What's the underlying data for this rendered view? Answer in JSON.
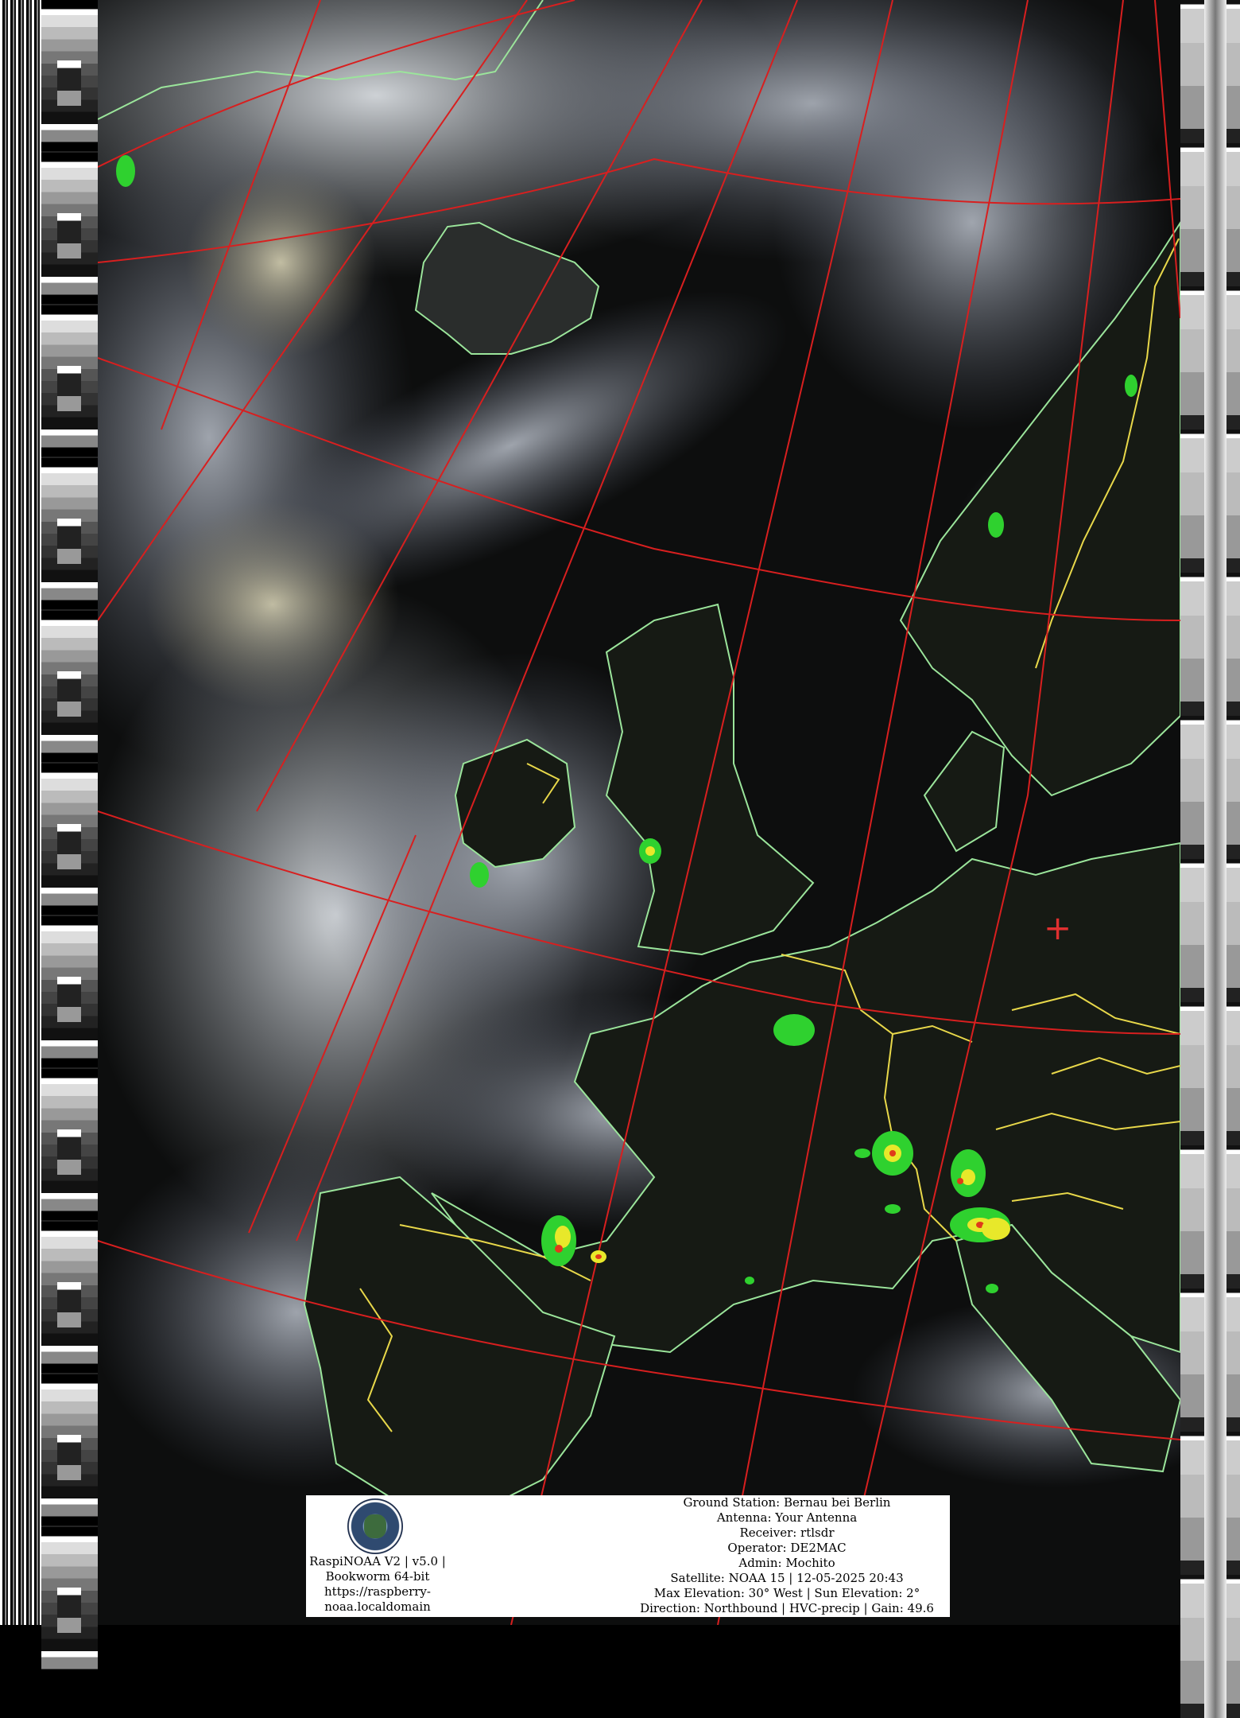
{
  "software": {
    "line1": "RaspiNOAA V2 | v5.0 |",
    "line2": "Bookworm 64-bit",
    "line3": "https://raspberry-",
    "line4": "noaa.localdomain"
  },
  "station": {
    "ground_station": "Ground Station: Bernau bei Berlin",
    "antenna": "Antenna: Your Antenna",
    "receiver": "Receiver: rtlsdr",
    "operator": "Operator: DE2MAC",
    "admin": "Admin: Mochito",
    "satellite": "Satellite: NOAA 15 | 12-05-2025 20:43",
    "elevation": "Max Elevation: 30° West | Sun Elevation: 2°",
    "direction": "Direction: Northbound | HVC-precip | Gain: 49.6"
  },
  "marker": {
    "glyph": "+",
    "color": "#e03030"
  },
  "colors": {
    "grid": "#d81f1f",
    "coastline": "#9be59b",
    "borders": "#e8d84a",
    "precip_green": "#2fd12f",
    "precip_yellow": "#e8e82a",
    "precip_red": "#e03a1a"
  }
}
